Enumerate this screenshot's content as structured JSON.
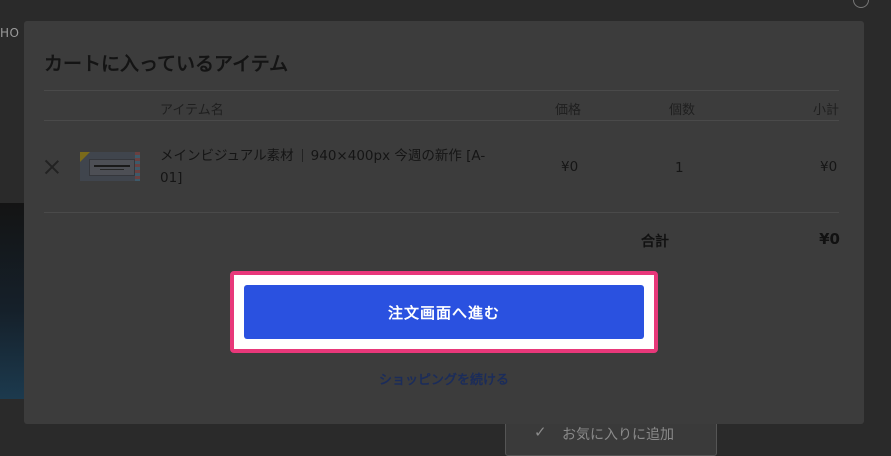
{
  "background": {
    "logo_text": "HO",
    "favorite_button_label": "お気に入りに追加"
  },
  "cart": {
    "title": "カートに入っているアイテム",
    "columns": {
      "item_name": "アイテム名",
      "price": "価格",
      "quantity": "個数",
      "subtotal": "小計"
    },
    "items": [
      {
        "name": "メインビジュアル素材",
        "spec": "940×400px 今週の新作 [A-01]",
        "price": "¥0",
        "quantity": "1",
        "subtotal": "¥0",
        "thumbnail_text": "NEW ARRIVAL"
      }
    ],
    "total_label": "合計",
    "total_value": "¥0",
    "checkout_button": "注文画面へ進む",
    "continue_link": "ショッピングを続ける"
  },
  "colors": {
    "primary_button": "#2a51e0",
    "highlight_border": "#e8387a",
    "overlay": "#2a2a2a"
  }
}
